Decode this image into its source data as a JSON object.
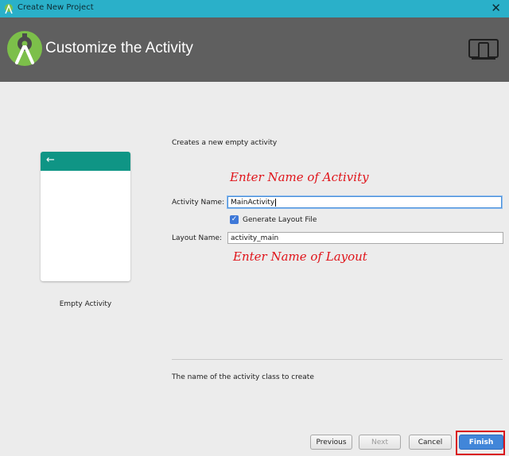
{
  "window": {
    "title": "Create New Project",
    "close_glyph": "✕"
  },
  "header": {
    "title": "Customize the Activity"
  },
  "template": {
    "name": "Empty Activity",
    "back_glyph": "←"
  },
  "form": {
    "description": "Creates a new empty activity",
    "activity_name_label": "Activity Name:",
    "activity_name_value": "MainActivity",
    "generate_layout_label": "Generate Layout File",
    "generate_layout_checked": true,
    "layout_name_label": "Layout Name:",
    "layout_name_value": "activity_main",
    "help_text": "The name of the activity class to create"
  },
  "annotations": {
    "activity_hint": "Enter Name of Activity",
    "layout_hint": "Enter Name of Layout"
  },
  "buttons": {
    "previous": "Previous",
    "next": "Next",
    "cancel": "Cancel",
    "finish": "Finish"
  },
  "colors": {
    "titlebar": "#2ab0c9",
    "header": "#5f5f5f",
    "preview_bar": "#0f9585",
    "annotation": "#e0141a",
    "finish": "#4186d9"
  }
}
